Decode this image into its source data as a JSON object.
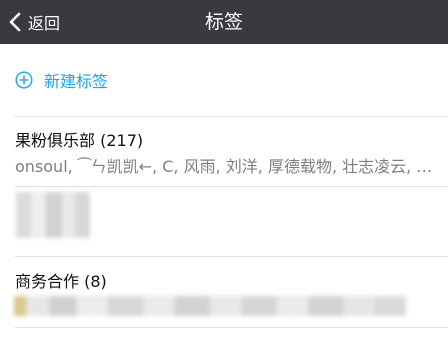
{
  "navbar": {
    "back_label": "返回",
    "title": "标签",
    "back_icon": "chevron-left-icon"
  },
  "new_tag": {
    "label": "新建标签",
    "icon": "plus-circle-icon"
  },
  "groups": [
    {
      "title": "果粉俱乐部 (217)",
      "members": "onsoul, ⁀ㄣ凯凯←, C, 风雨, 刘洋, 厚德载物, 壮志凌云, 小明"
    },
    {
      "title": "商务合作 (8)",
      "members": ""
    }
  ],
  "colors": {
    "navbar_bg": "#393a3f",
    "accent": "#1aa6ea",
    "primary_text": "#111111",
    "secondary_text": "#7f7f7f"
  }
}
